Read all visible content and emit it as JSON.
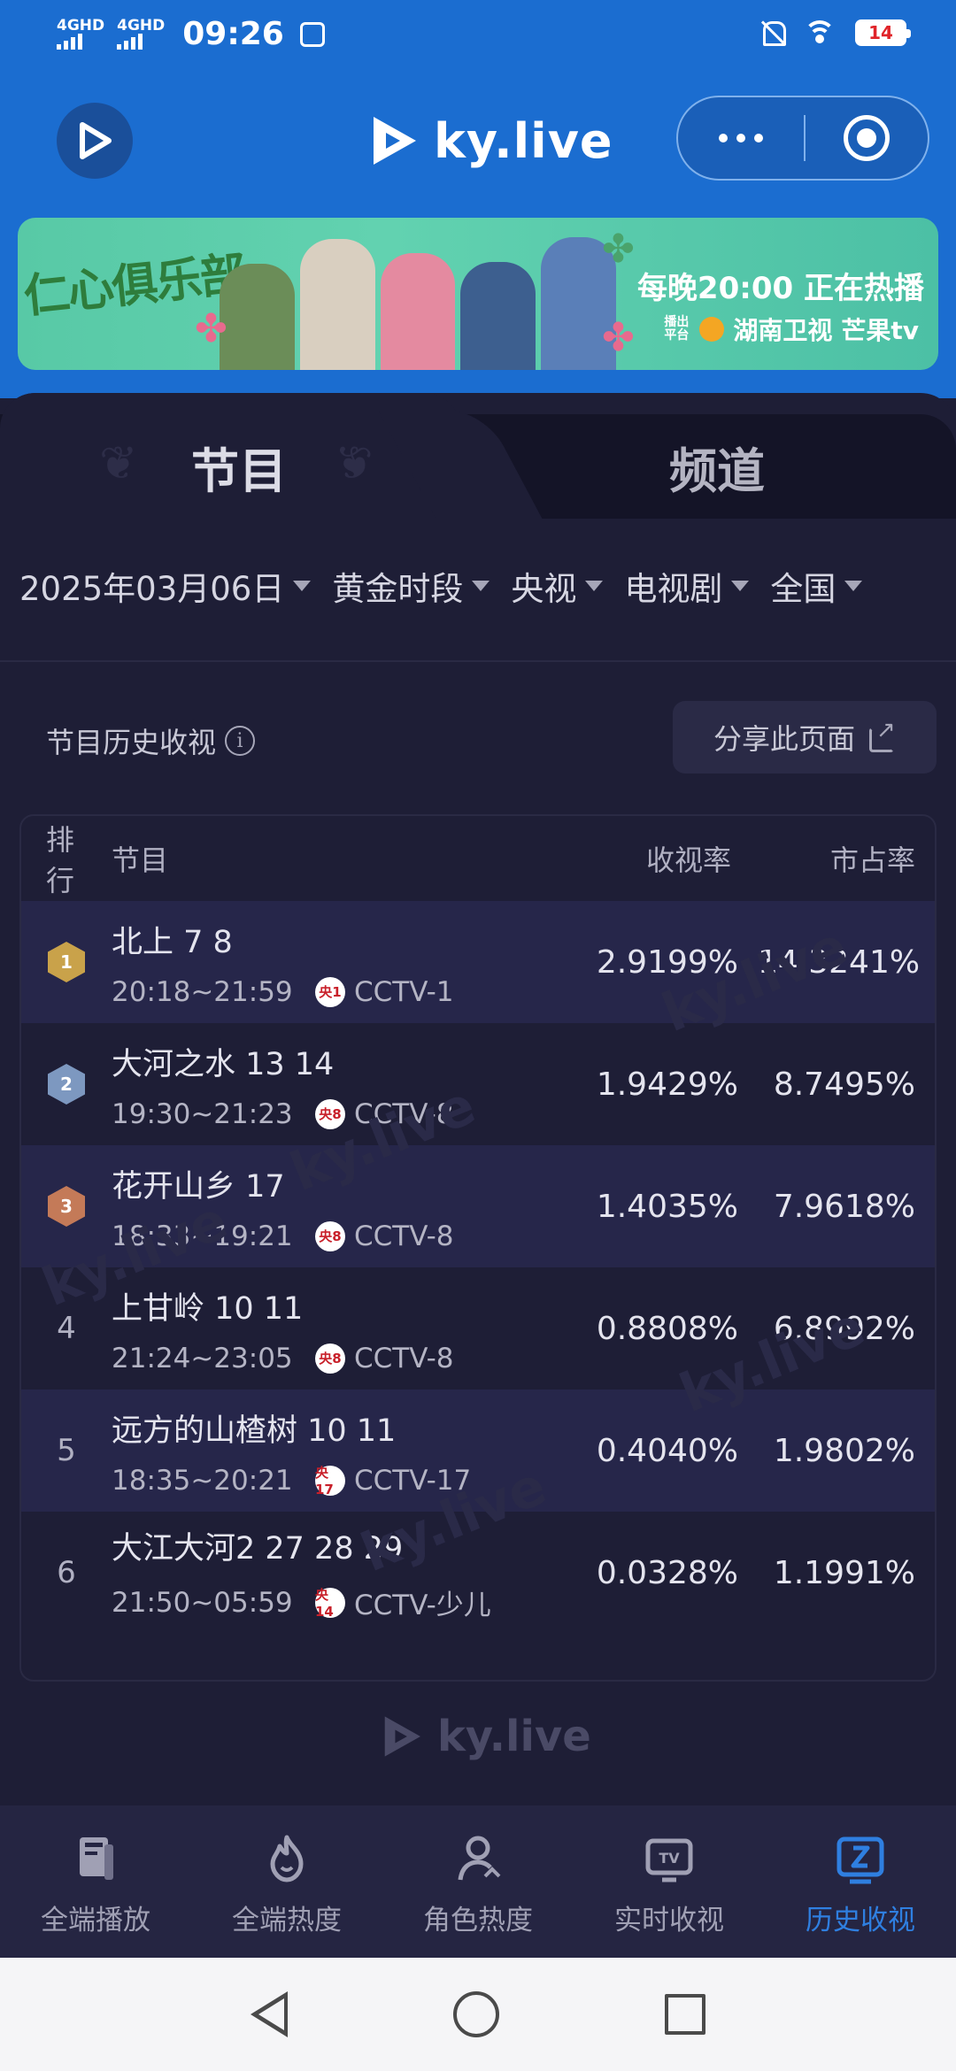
{
  "status_bar": {
    "network1": "4GHD",
    "network2": "4GHD",
    "time": "09:26",
    "battery": "14"
  },
  "header": {
    "brand": "ky.live"
  },
  "banner": {
    "show_title": "仁心俱乐部",
    "slogan": "每晚20:00 正在热播",
    "platform_label": "播出平台",
    "platform1": "湖南卫视",
    "platform2": "芒果tv"
  },
  "tabs": [
    {
      "label": "节目",
      "active": true
    },
    {
      "label": "频道",
      "active": false
    }
  ],
  "filters": [
    {
      "label": "2025年03月06日"
    },
    {
      "label": "黄金时段"
    },
    {
      "label": "央视"
    },
    {
      "label": "电视剧"
    },
    {
      "label": "全国"
    }
  ],
  "section": {
    "title": "节目历史收视",
    "info_icon": "i",
    "share_label": "分享此页面"
  },
  "table": {
    "headers": {
      "rank": "排行",
      "program": "节目",
      "rating": "收视率",
      "share": "市占率"
    },
    "rows": [
      {
        "rank": "1",
        "name": "北上 7 8",
        "time": "20:18~21:59",
        "badge": "央1",
        "channel": "CCTV-1",
        "rating": "2.9199%",
        "share": "14.3241%"
      },
      {
        "rank": "2",
        "name": "大河之水 13 14",
        "time": "19:30~21:23",
        "badge": "央8",
        "channel": "CCTV-8",
        "rating": "1.9429%",
        "share": "8.7495%"
      },
      {
        "rank": "3",
        "name": "花开山乡 17",
        "time": "18:33~19:21",
        "badge": "央8",
        "channel": "CCTV-8",
        "rating": "1.4035%",
        "share": "7.9618%"
      },
      {
        "rank": "4",
        "name": "上甘岭 10 11",
        "time": "21:24~23:05",
        "badge": "央8",
        "channel": "CCTV-8",
        "rating": "0.8808%",
        "share": "6.8992%"
      },
      {
        "rank": "5",
        "name": "远方的山楂树 10 11",
        "time": "18:35~20:21",
        "badge": "央17",
        "channel": "CCTV-17",
        "rating": "0.4040%",
        "share": "1.9802%"
      },
      {
        "rank": "6",
        "name": "大江大河2 27 28 29",
        "time": "21:50~05:59",
        "badge": "央14",
        "channel": "CCTV-少儿",
        "rating": "0.0328%",
        "share": "1.1991%"
      }
    ]
  },
  "watermark": "ky.live",
  "footer_brand": "ky.live",
  "bottom_nav": [
    {
      "label": "全端播放",
      "icon": "book-icon",
      "active": false
    },
    {
      "label": "全端热度",
      "icon": "flame-icon",
      "active": false
    },
    {
      "label": "角色热度",
      "icon": "person-icon",
      "active": false
    },
    {
      "label": "实时收视",
      "icon": "tv-icon",
      "active": false
    },
    {
      "label": "历史收视",
      "icon": "history-icon",
      "active": true
    }
  ],
  "colors": {
    "header_blue": "#1b6dd0",
    "panel_bg": "#1e1e36",
    "active_blue": "#2f7fe0",
    "gold": "#c9a24a",
    "silver": "#7d98c0",
    "bronze": "#c47a58"
  }
}
